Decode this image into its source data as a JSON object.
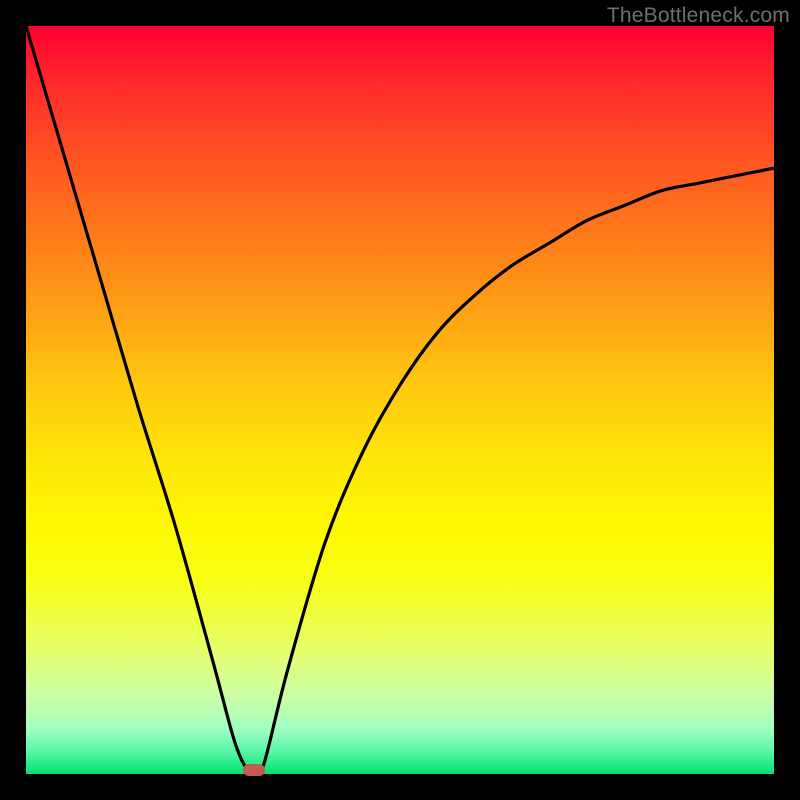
{
  "watermark": "TheBottleneck.com",
  "chart_data": {
    "type": "line",
    "title": "",
    "xlabel": "",
    "ylabel": "",
    "xlim": [
      0,
      100
    ],
    "ylim": [
      0,
      100
    ],
    "grid": false,
    "series": [
      {
        "name": "curve",
        "x": [
          0,
          5,
          10,
          15,
          20,
          25,
          28,
          30,
          31,
          32,
          35,
          40,
          45,
          50,
          55,
          60,
          65,
          70,
          75,
          80,
          85,
          90,
          95,
          100
        ],
        "y": [
          100,
          83,
          66,
          49,
          33,
          15,
          4,
          0,
          0,
          2,
          14,
          31,
          43,
          52,
          59,
          64,
          68,
          71,
          74,
          76,
          78,
          79,
          80,
          81
        ]
      }
    ],
    "marker": {
      "x": 30.5,
      "y": 0
    }
  },
  "colors": {
    "curve_stroke": "#000000",
    "marker_fill": "#c45a50"
  }
}
